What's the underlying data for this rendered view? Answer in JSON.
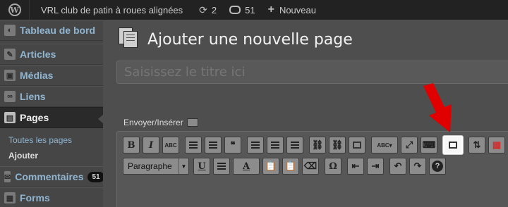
{
  "adminbar": {
    "site_name": "VRL club de patin à roues alignées",
    "updates_count": "2",
    "comments_count": "51",
    "new_label": "Nouveau"
  },
  "sidebar": {
    "items": [
      {
        "label": "Tableau de bord",
        "icon": "dashboard-icon"
      },
      {
        "label": "Articles",
        "icon": "pin-icon"
      },
      {
        "label": "Médias",
        "icon": "media-icon"
      },
      {
        "label": "Liens",
        "icon": "link-icon"
      },
      {
        "label": "Pages",
        "icon": "pages-icon"
      },
      {
        "label": "Commentaires",
        "icon": "comments-icon",
        "count": "51"
      },
      {
        "label": "Forms",
        "icon": "forms-icon"
      }
    ],
    "submenu": [
      "Toutes les pages",
      "Ajouter"
    ]
  },
  "main": {
    "title": "Ajouter une nouvelle page",
    "title_placeholder": "Saisissez le titre ici",
    "upload_label": "Envoyer/Insérer"
  },
  "toolbar": {
    "row1": [
      "B",
      "I",
      "ABC",
      "unordered-list",
      "ordered-list",
      "blockquote",
      "align-left",
      "align-center",
      "align-right",
      "insert-link",
      "unlink",
      "more-tag",
      "spellcheck",
      "fullscreen",
      "kitchen-sink",
      "insert-page-break",
      "move-up",
      "color-apps"
    ],
    "format_select": "Paragraphe",
    "row2": [
      "U",
      "justify",
      "A",
      "paste-text",
      "paste-word",
      "clear-format",
      "Ω",
      "outdent",
      "indent",
      "undo",
      "redo",
      "?"
    ]
  },
  "colors": {
    "admin_bar": "#222222",
    "sidebar": "#464646",
    "link_blue": "#8fb5d1",
    "arrow_red": "#e00000"
  }
}
